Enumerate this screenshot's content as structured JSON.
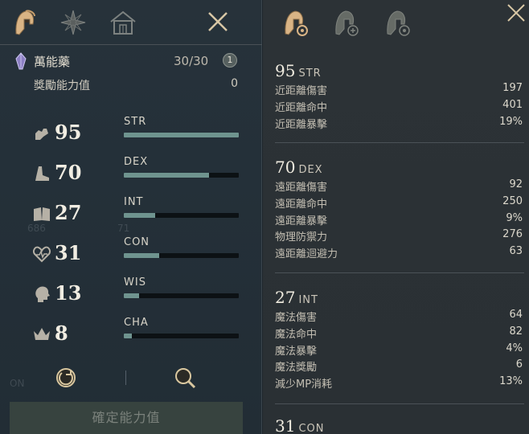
{
  "left": {
    "tabs": [
      {
        "name": "character-tab",
        "icon": "helmet-icon"
      },
      {
        "name": "star-tab",
        "icon": "compass-star-icon"
      },
      {
        "name": "house-tab",
        "icon": "house-icon"
      }
    ],
    "potion": {
      "name": "萬能藥",
      "count": "30/30",
      "info": "1"
    },
    "bonus": {
      "label": "獎勵能力值",
      "value": "0"
    },
    "stats": [
      {
        "code": "STR",
        "value": "95",
        "fill": 1.0,
        "icon": "strength-arm-icon"
      },
      {
        "code": "DEX",
        "value": "70",
        "fill": 0.74,
        "icon": "boot-icon"
      },
      {
        "code": "INT",
        "value": "27",
        "fill": 0.27,
        "icon": "book-icon"
      },
      {
        "code": "CON",
        "value": "31",
        "fill": 0.31,
        "icon": "heart-icon"
      },
      {
        "code": "WIS",
        "value": "13",
        "fill": 0.13,
        "icon": "head-icon"
      },
      {
        "code": "CHA",
        "value": "8",
        "fill": 0.07,
        "icon": "crown-icon"
      }
    ],
    "confirm_label": "確定能力值",
    "ghost": {
      "a": "686",
      "b": "71",
      "c": "ON"
    }
  },
  "right": {
    "sections": [
      {
        "num": "95",
        "code": "STR",
        "rows": [
          {
            "label": "近距離傷害",
            "value": "197"
          },
          {
            "label": "近距離命中",
            "value": "401"
          },
          {
            "label": "近距離暴擊",
            "value": "19%"
          }
        ]
      },
      {
        "num": "70",
        "code": "DEX",
        "rows": [
          {
            "label": "遠距離傷害",
            "value": "92"
          },
          {
            "label": "遠距離命中",
            "value": "250"
          },
          {
            "label": "遠距離暴擊",
            "value": "9%"
          },
          {
            "label": "物理防禦力",
            "value": "276"
          },
          {
            "label": "遠距離迴避力",
            "value": "63"
          }
        ]
      },
      {
        "num": "27",
        "code": "INT",
        "rows": [
          {
            "label": "魔法傷害",
            "value": "64"
          },
          {
            "label": "魔法命中",
            "value": "82"
          },
          {
            "label": "魔法暴擊",
            "value": "4%"
          },
          {
            "label": "魔法獎勵",
            "value": "6"
          },
          {
            "label": "減少MP消耗",
            "value": "13%"
          }
        ]
      },
      {
        "num": "31",
        "code": "CON",
        "rows": []
      }
    ]
  }
}
